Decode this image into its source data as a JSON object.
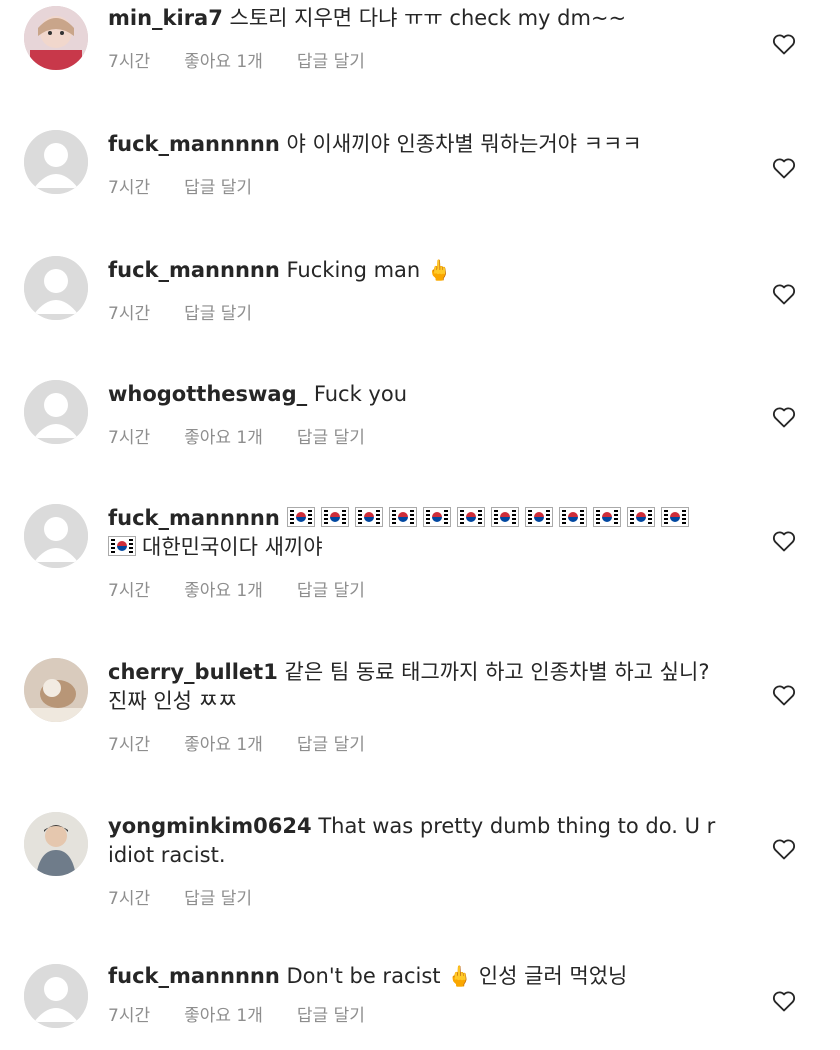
{
  "comments": [
    {
      "username": "min_kira7",
      "text": "스토리 지우면 다냐 ㅠㅠ check my dm~~",
      "time": "7시간",
      "likes": "좋아요 1개",
      "reply": "답글 달기",
      "avatar": "photo"
    },
    {
      "username": "fuck_mannnnn",
      "text": "야 이새끼야 인종차별 뭐하는거야 ㅋㅋㅋ",
      "time": "7시간",
      "reply": "답글 달기",
      "avatar": "default"
    },
    {
      "username": "fuck_mannnnn",
      "text": "Fucking man",
      "emoji": "middle-finger",
      "time": "7시간",
      "reply": "답글 달기",
      "avatar": "default"
    },
    {
      "username": "whogottheswag_",
      "text": "Fuck you",
      "time": "7시간",
      "likes": "좋아요 1개",
      "reply": "답글 달기",
      "avatar": "default"
    },
    {
      "username": "fuck_mannnnn",
      "flags": 13,
      "text": "대한민국이다 새끼야",
      "time": "7시간",
      "likes": "좋아요 1개",
      "reply": "답글 달기",
      "avatar": "default"
    },
    {
      "username": "cherry_bullet1",
      "text": "같은 팀 동료 태그까지 하고 인종차별 하고 싶니? 진짜 인성 ㅉㅉ",
      "time": "7시간",
      "likes": "좋아요 1개",
      "reply": "답글 달기",
      "avatar": "photo"
    },
    {
      "username": "yongminkim0624",
      "text": "That was pretty dumb thing to do. U r  idiot racist.",
      "time": "7시간",
      "reply": "답글 달기",
      "avatar": "photo"
    },
    {
      "username": "fuck_mannnnn",
      "text": "Don't be racist",
      "text_after": "인성 글러 먹었닝",
      "emoji": "middle-finger",
      "time": "7시간",
      "likes": "좋아요 1개",
      "reply": "답글 달기",
      "avatar": "default"
    }
  ],
  "icons": {
    "like": "heart-outline-icon",
    "avatar_default": "default-avatar-icon",
    "emoji": "middle-finger-emoji",
    "flag": "south-korea-flag-emoji"
  }
}
